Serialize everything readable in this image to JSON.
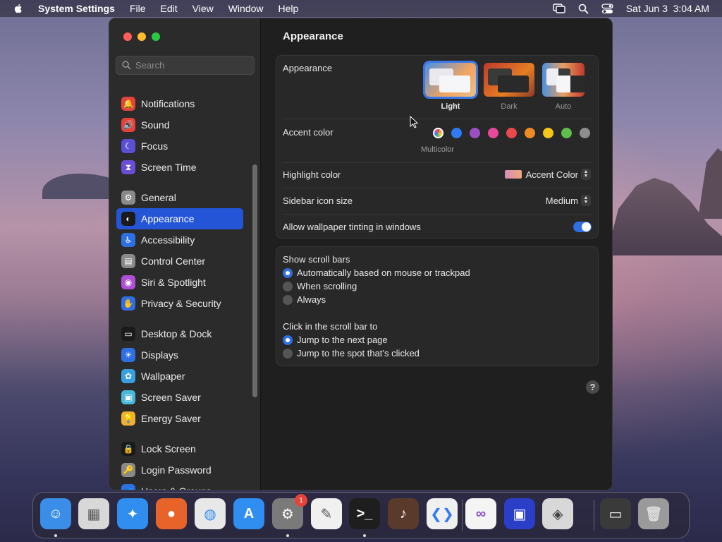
{
  "menubar": {
    "app": "System Settings",
    "items": [
      "File",
      "Edit",
      "View",
      "Window",
      "Help"
    ],
    "clock": "Sat Jun 3  3:04 AM"
  },
  "sidebar": {
    "search_placeholder": "Search",
    "groups": [
      [
        {
          "label": "Notifications",
          "icon": "bell-icon",
          "color": "#e5433a"
        },
        {
          "label": "Sound",
          "icon": "speaker-icon",
          "color": "#e5433a"
        },
        {
          "label": "Focus",
          "icon": "moon-icon",
          "color": "#5b4fd6"
        },
        {
          "label": "Screen Time",
          "icon": "hourglass-icon",
          "color": "#6a4fd6"
        }
      ],
      [
        {
          "label": "General",
          "icon": "gear-icon",
          "color": "#8a8a8a"
        },
        {
          "label": "Appearance",
          "icon": "appearance-icon",
          "color": "#1a1a1a",
          "selected": true
        },
        {
          "label": "Accessibility",
          "icon": "accessibility-icon",
          "color": "#2f6fe4"
        },
        {
          "label": "Control Center",
          "icon": "control-center-icon",
          "color": "#8a8a8a"
        },
        {
          "label": "Siri & Spotlight",
          "icon": "siri-icon",
          "color": "#b04fd6"
        },
        {
          "label": "Privacy & Security",
          "icon": "hand-icon",
          "color": "#2f6fe4"
        }
      ],
      [
        {
          "label": "Desktop & Dock",
          "icon": "dock-icon",
          "color": "#1a1a1a"
        },
        {
          "label": "Displays",
          "icon": "sun-icon",
          "color": "#2f6fe4"
        },
        {
          "label": "Wallpaper",
          "icon": "flower-icon",
          "color": "#3aa0e0"
        },
        {
          "label": "Screen Saver",
          "icon": "screensaver-icon",
          "color": "#4ab8d8"
        },
        {
          "label": "Energy Saver",
          "icon": "bulb-icon",
          "color": "#f0b030"
        }
      ],
      [
        {
          "label": "Lock Screen",
          "icon": "lock-icon",
          "color": "#1a1a1a"
        },
        {
          "label": "Login Password",
          "icon": "padlock-icon",
          "color": "#8a8a8a"
        },
        {
          "label": "Users & Groups",
          "icon": "users-icon",
          "color": "#2f6fe4"
        }
      ]
    ]
  },
  "content": {
    "title": "Appearance",
    "appearance": {
      "label": "Appearance",
      "options": [
        "Light",
        "Dark",
        "Auto"
      ],
      "selected": "Light"
    },
    "accent": {
      "label": "Accent color",
      "colors": [
        "multicolor",
        "#2f7af5",
        "#9b4fc0",
        "#e8489a",
        "#e9494b",
        "#f08a24",
        "#f5c518",
        "#5fbe4c",
        "#8e8e8e"
      ],
      "selected_label": "Multicolor"
    },
    "highlight": {
      "label": "Highlight color",
      "value": "Accent Color"
    },
    "icon_size": {
      "label": "Sidebar icon size",
      "value": "Medium"
    },
    "tinting": {
      "label": "Allow wallpaper tinting in windows",
      "on": true
    },
    "scroll_bars": {
      "label": "Show scroll bars",
      "options": [
        "Automatically based on mouse or trackpad",
        "When scrolling",
        "Always"
      ],
      "selected": 0
    },
    "click_scroll": {
      "label": "Click in the scroll bar to",
      "options": [
        "Jump to the next page",
        "Jump to the spot that’s clicked"
      ],
      "selected": 0
    },
    "help": "?"
  },
  "dock": {
    "apps": [
      {
        "name": "finder-icon",
        "color": "#3a8ee8"
      },
      {
        "name": "launchpad-icon",
        "color": "#d8d8d8"
      },
      {
        "name": "safari-icon",
        "color": "#2f8ef0"
      },
      {
        "name": "firefox-icon",
        "color": "#e8632a"
      },
      {
        "name": "chrome-icon",
        "color": "#e8e8e8"
      },
      {
        "name": "app-store-icon",
        "color": "#2f8ef0"
      },
      {
        "name": "system-settings-icon",
        "color": "#7a7a7a",
        "badge": "1"
      },
      {
        "name": "textedit-icon",
        "color": "#f0f0f0"
      },
      {
        "name": "terminal-icon",
        "color": "#1e1e1e"
      },
      {
        "name": "garageband-icon",
        "color": "#5a3a2a"
      },
      {
        "name": "vscode-icon",
        "color": "#f0f0f0"
      },
      {
        "name": "visual-studio-icon",
        "color": "#f4f4f4"
      },
      {
        "name": "simulator-icon",
        "color": "#2a3ec8"
      },
      {
        "name": "boot-camp-icon",
        "color": "#d8d8d8"
      },
      {
        "name": "screenshot-folder-icon",
        "color": "#3a3a3a"
      },
      {
        "name": "trash-icon",
        "color": "#9a9a9a"
      }
    ]
  }
}
